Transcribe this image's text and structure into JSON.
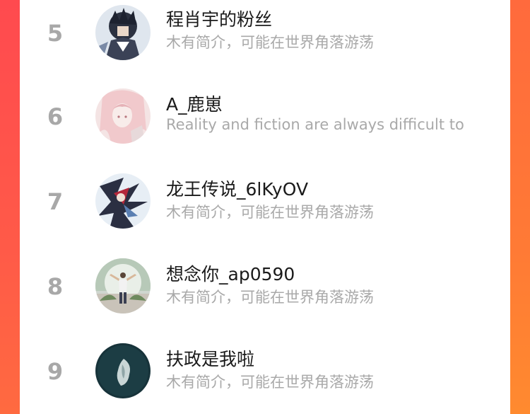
{
  "leaderboard": {
    "items": [
      {
        "rank": "5",
        "name": "程肖宇的粉丝",
        "bio": "木有简介，可能在世界角落游荡",
        "avatar_icon": "anime-character-avatar"
      },
      {
        "rank": "6",
        "name": "A_鹿崽",
        "bio": "Reality and fiction are always difficult to",
        "avatar_icon": "anime-girl-avatar"
      },
      {
        "rank": "7",
        "name": "龙王传说_6lKyOV",
        "bio": "木有简介，可能在世界角落游荡",
        "avatar_icon": "anime-warrior-avatar"
      },
      {
        "rank": "8",
        "name": "想念你_ap0590",
        "bio": "木有简介，可能在世界角落游荡",
        "avatar_icon": "person-photo-avatar"
      },
      {
        "rank": "9",
        "name": "扶政是我啦",
        "bio": "木有简介，可能在世界角落游荡",
        "avatar_icon": "dark-sea-avatar"
      }
    ]
  },
  "colors": {
    "left_edge": "#ff4a4f",
    "right_edge": "#ff7a35",
    "rank_text": "#a8a8a8",
    "name_text": "#1a1a1a",
    "bio_text": "#a9a9a9"
  }
}
